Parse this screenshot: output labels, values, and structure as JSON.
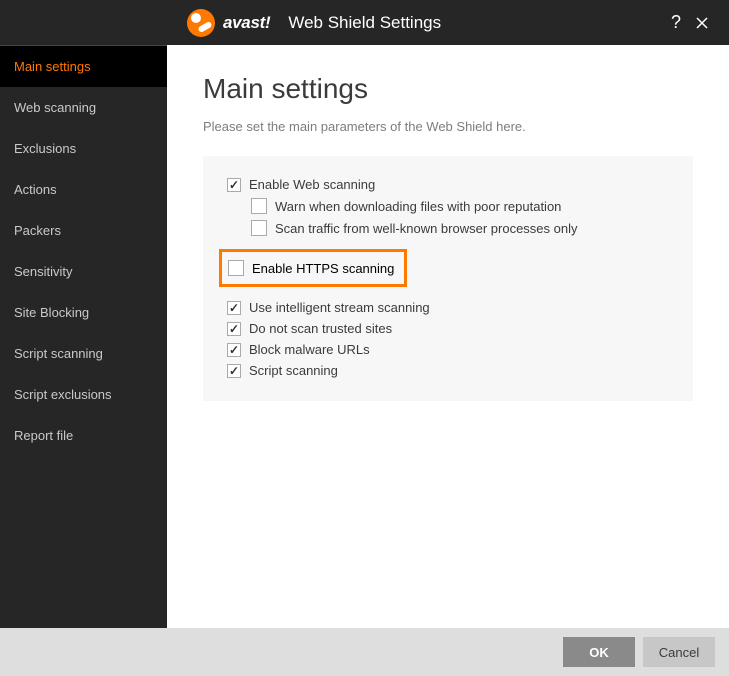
{
  "titlebar": {
    "brand": "avast!",
    "title": "Web Shield Settings"
  },
  "sidebar": {
    "items": [
      {
        "label": "Main settings",
        "active": true
      },
      {
        "label": "Web scanning",
        "active": false
      },
      {
        "label": "Exclusions",
        "active": false
      },
      {
        "label": "Actions",
        "active": false
      },
      {
        "label": "Packers",
        "active": false
      },
      {
        "label": "Sensitivity",
        "active": false
      },
      {
        "label": "Site Blocking",
        "active": false
      },
      {
        "label": "Script scanning",
        "active": false
      },
      {
        "label": "Script exclusions",
        "active": false
      },
      {
        "label": "Report file",
        "active": false
      }
    ]
  },
  "main": {
    "heading": "Main settings",
    "description": "Please set the main parameters of the Web Shield here.",
    "options": {
      "enable_web_scanning": {
        "label": "Enable Web scanning",
        "checked": true
      },
      "warn_poor_reputation": {
        "label": "Warn when downloading files with poor reputation",
        "checked": false
      },
      "scan_known_browser": {
        "label": "Scan traffic from well-known browser processes only",
        "checked": false
      },
      "enable_https_scanning": {
        "label": "Enable HTTPS scanning",
        "checked": false
      },
      "intelligent_stream": {
        "label": "Use intelligent stream scanning",
        "checked": true
      },
      "do_not_scan_trusted": {
        "label": "Do not scan trusted sites",
        "checked": true
      },
      "block_malware_urls": {
        "label": "Block malware URLs",
        "checked": true
      },
      "script_scanning": {
        "label": "Script scanning",
        "checked": true
      }
    }
  },
  "footer": {
    "ok_label": "OK",
    "cancel_label": "Cancel"
  },
  "colors": {
    "accent": "#ff7800",
    "panel": "#f7f7f7",
    "sidebar_bg": "#262626"
  }
}
